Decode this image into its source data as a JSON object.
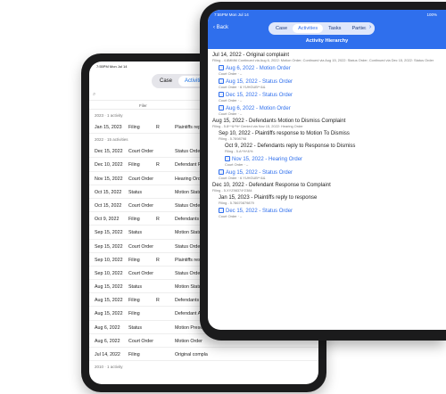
{
  "back_tablet": {
    "status_time": "7:55PM  Mon Jul 14",
    "tabs": [
      "Case",
      "Activities"
    ],
    "active_tab": "Activities",
    "column_header": "Filer",
    "sections": [
      {
        "label": "2023 · 1 activity",
        "rows": [
          {
            "date": "Jan 15, 2023",
            "type": "Filing",
            "party": "R",
            "desc": "Plaintiffs reply"
          }
        ]
      },
      {
        "label": "2022 · 15 activities",
        "rows": [
          {
            "date": "Dec 15, 2022",
            "type": "Court Order",
            "party": "",
            "desc": "Status Order"
          },
          {
            "date": "Dec 10, 2022",
            "type": "Filing",
            "party": "R",
            "desc": "Defendant Re"
          },
          {
            "date": "Nov 15, 2022",
            "type": "Court Order",
            "party": "",
            "desc": "Hearing Order"
          },
          {
            "date": "Oct 15, 2022",
            "type": "Status",
            "party": "",
            "desc": "Motion Status"
          },
          {
            "date": "Oct 15, 2022",
            "type": "Court Order",
            "party": "",
            "desc": "Status Order"
          },
          {
            "date": "Oct 9, 2022",
            "type": "Filing",
            "party": "R",
            "desc": "Defendants re"
          },
          {
            "date": "Sep 15, 2022",
            "type": "Status",
            "party": "",
            "desc": "Motion Status"
          },
          {
            "date": "Sep 15, 2022",
            "type": "Court Order",
            "party": "",
            "desc": "Status Order"
          },
          {
            "date": "Sep 10, 2022",
            "type": "Filing",
            "party": "R",
            "desc": "Plaintiffs resp"
          },
          {
            "date": "Sep 10, 2022",
            "type": "Court Order",
            "party": "",
            "desc": "Status Order"
          },
          {
            "date": "Aug 15, 2022",
            "type": "Status",
            "party": "",
            "desc": "Motion Status"
          },
          {
            "date": "Aug 15, 2022",
            "type": "Filing",
            "party": "R",
            "desc": "Defendants M"
          },
          {
            "date": "Aug 15, 2022",
            "type": "Filing",
            "party": "",
            "desc": "Defendant Ap"
          },
          {
            "date": "Aug 6, 2022",
            "type": "Status",
            "party": "",
            "desc": "Motion Presen"
          },
          {
            "date": "Aug 6, 2022",
            "type": "Court Order",
            "party": "",
            "desc": "Motion Order"
          },
          {
            "date": "Jul 14, 2022",
            "type": "Filing",
            "party": "",
            "desc": "Original compla"
          }
        ]
      },
      {
        "label": "2010 · 1 activity",
        "rows": []
      }
    ]
  },
  "front_tablet": {
    "status_time": "7:55PM  Mon Jul 14",
    "battery": "100%",
    "back_label": "Back",
    "tabs": [
      "Case",
      "Activities",
      "Tasks",
      "Parties"
    ],
    "active_tab": "Activities",
    "forward_icon": "›",
    "title": "Activity Hierarchy",
    "items": [
      {
        "level": 0,
        "icon": false,
        "link": false,
        "title": "Jul 14, 2022 - Original complaint",
        "sub": "Filing - 4.8MMM Continued via Aug 6, 2022: Motion Order; Continued via Aug 15, 2022: Status Order; Continued via Dec 15, 2022: Status Order"
      },
      {
        "level": 1,
        "icon": true,
        "link": true,
        "title": "Aug 6, 2022 - Motion Order",
        "sub": "Court Order · –"
      },
      {
        "level": 1,
        "icon": true,
        "link": true,
        "title": "Aug 15, 2022 - Status Order",
        "sub": "Court Order · 6.YUHGUB*^&&"
      },
      {
        "level": 1,
        "icon": true,
        "link": true,
        "title": "Dec 15, 2022 - Status Order",
        "sub": "Court Order · –"
      },
      {
        "level": 1,
        "icon": true,
        "link": true,
        "title": "Aug 6, 2022 - Motion Order",
        "sub": "Court Order · –"
      },
      {
        "level": 0,
        "icon": false,
        "link": false,
        "title": "Aug 15, 2022 - Defendants Motion to Dismiss Complaint",
        "sub": "Filing - 5.8^^&*%^ Denied via Nov 15, 2022: Hearing Order"
      },
      {
        "level": 1,
        "icon": false,
        "link": false,
        "title": "Sep 10, 2022 - Plaintiffs response to Motion To Dismiss",
        "sub": "Filing - 5.7898798"
      },
      {
        "level": 2,
        "icon": false,
        "link": false,
        "title": "Oct 9, 2022 - Defendants reply to Response to Dismiss",
        "sub": "Filing - 5.A^%*&%"
      },
      {
        "level": 2,
        "icon": true,
        "link": true,
        "title": "Nov 15, 2022 - Hearing Order",
        "sub": "Court Order · –"
      },
      {
        "level": 1,
        "icon": true,
        "link": true,
        "title": "Aug 15, 2022 - Status Order",
        "sub": "Court Order · 6.YUHGUB*^&&"
      },
      {
        "level": 0,
        "icon": false,
        "link": false,
        "title": "Dec 10, 2022 - Defendant Response to Complaint",
        "sub": "Filing - 5.XYZ98374*2384"
      },
      {
        "level": 1,
        "icon": false,
        "link": false,
        "title": "Jan 15, 2023 - Plaintiffs reply to response",
        "sub": "Filing - 5.78670879879"
      },
      {
        "level": 1,
        "icon": true,
        "link": true,
        "title": "Dec 15, 2022 - Status Order",
        "sub": "Court Order · –"
      }
    ]
  }
}
